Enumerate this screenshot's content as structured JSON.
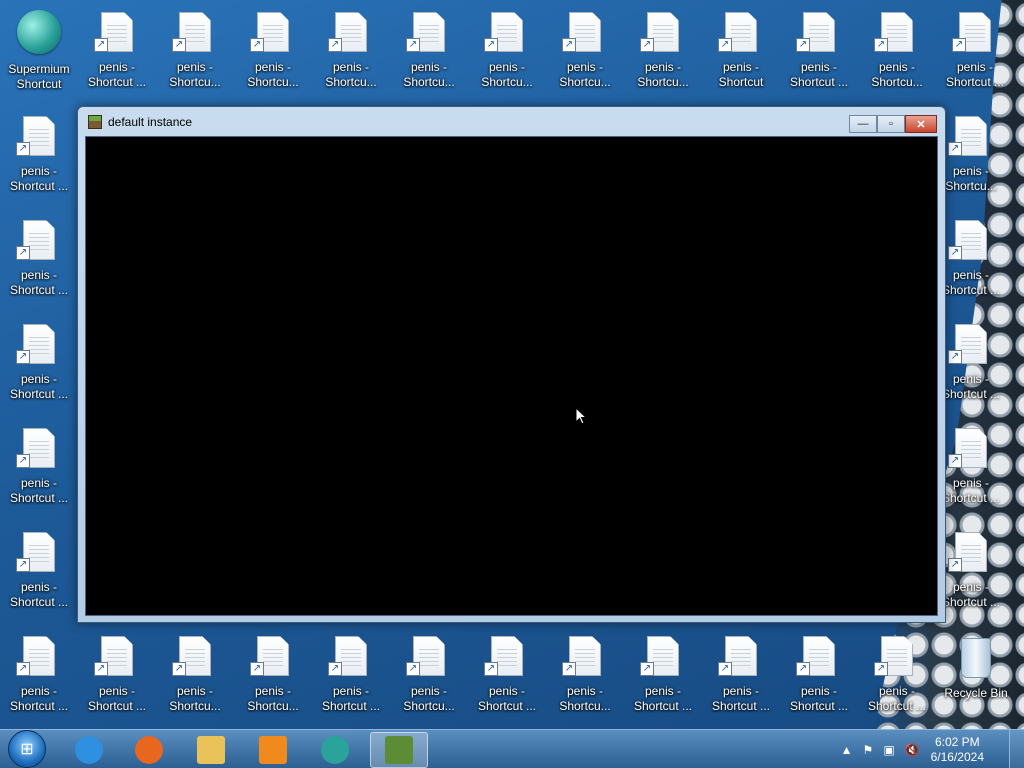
{
  "desktop": {
    "special_icons": [
      {
        "key": "supermium",
        "label": "Supermium Shortcut"
      },
      {
        "key": "recycle_bin",
        "label": "Recycle Bin"
      }
    ],
    "top_row_labels": [
      "penis - Shortcut ...",
      "penis - Shortcu...",
      "penis - Shortcu...",
      "penis - Shortcu...",
      "penis - Shortcu...",
      "penis - Shortcu...",
      "penis - Shortcu...",
      "penis - Shortcu...",
      "penis - Shortcut",
      "penis - Shortcut ...",
      "penis - Shortcu...",
      "penis - Shortcut ..."
    ],
    "left_col_labels": [
      "penis - Shortcut ...",
      "penis - Shortcut ...",
      "penis - Shortcut ...",
      "penis - Shortcut ...",
      "penis - Shortcut ..."
    ],
    "right_col_labels": [
      "penis - Shortcu...",
      "penis - Shortcut ...",
      "penis - Shortcut ...",
      "penis - Shortcut ...",
      "penis - Shortcut ..."
    ],
    "bottom_row_labels": [
      "penis - Shortcut ...",
      "penis - Shortcut ...",
      "penis - Shortcu...",
      "penis - Shortcu...",
      "penis - Shortcut ...",
      "penis - Shortcu...",
      "penis - Shortcut ...",
      "penis - Shortcu...",
      "penis - Shortcut ...",
      "penis - Shortcut ...",
      "penis - Shortcut ...",
      "penis - Shortcut ..."
    ]
  },
  "window": {
    "title": "default instance",
    "minimize_glyph": "—",
    "maximize_glyph": "▫",
    "close_glyph": "✕"
  },
  "taskbar": {
    "start_glyph": "⊞",
    "apps": [
      {
        "name": "internet-explorer",
        "color": "#2f8fe0"
      },
      {
        "name": "firefox",
        "color": "#e8661e"
      },
      {
        "name": "file-explorer",
        "color": "#e9c25a"
      },
      {
        "name": "media-player",
        "color": "#f08a1c"
      },
      {
        "name": "supermium",
        "color": "#2aa39a"
      },
      {
        "name": "minecraft",
        "color": "#5d8c36"
      }
    ],
    "tray": {
      "chevron": "▲",
      "flag": "⚑",
      "network": "▣",
      "volume": "🔇",
      "time": "6:02 PM",
      "date": "6/16/2024"
    }
  }
}
